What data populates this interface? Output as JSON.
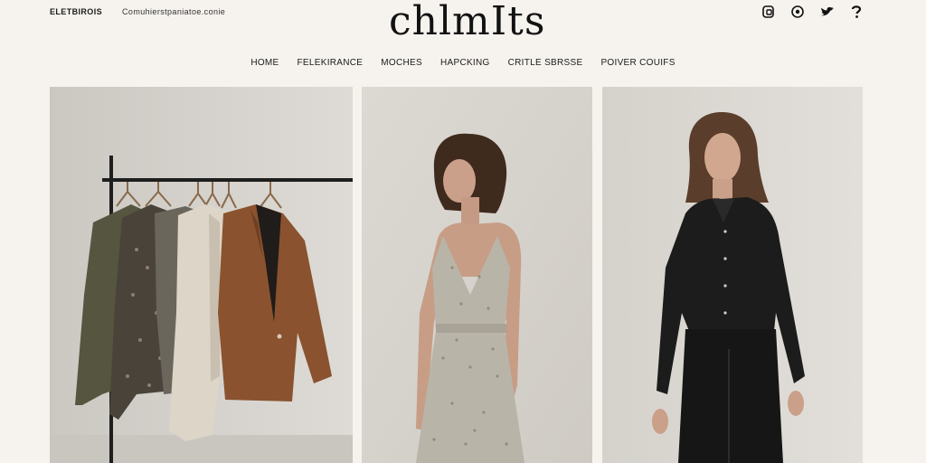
{
  "header": {
    "top_left_primary": "ELETBIROIS",
    "top_left_secondary": "Comuhierstpaniatoe.conie",
    "logo": "chlmIts",
    "social_icons": [
      "instagram-icon",
      "pinterest-icon",
      "twitter-icon",
      "help-icon"
    ]
  },
  "nav": {
    "items": [
      "HOME",
      "FELEKIRANCE",
      "MOCHES",
      "HAPCKING",
      "CRITLE SBRSSE",
      "POIVER COUIFS"
    ]
  },
  "gallery": {
    "items": [
      "clothing-rack-photo",
      "floral-dress-photo",
      "black-outfit-photo"
    ]
  },
  "colors": {
    "background": "#f6f3ee",
    "text": "#1b1b1b"
  }
}
